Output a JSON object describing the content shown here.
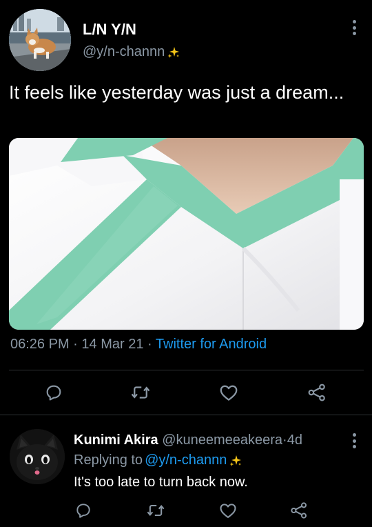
{
  "tweet": {
    "author_name": "L/N Y/N",
    "author_handle": "@y/n-channn",
    "text": "It feels like yesterday was just a dream...",
    "time": "06:26 PM",
    "date": "14 Mar 21",
    "source": "Twitter for Android",
    "meta_separator": "·"
  },
  "reply": {
    "author_name": "Kunimi Akira",
    "author_handle": "@kuneemeeakeera",
    "age": "4d",
    "replying_prefix": "Replying to",
    "replying_to": "@y/n-channn",
    "text": "It's too late to turn back now.",
    "separator": "·"
  },
  "icons": {
    "reply": "reply-icon",
    "retweet": "retweet-icon",
    "like": "heart-icon",
    "share": "share-icon",
    "more": "more-vertical-icon",
    "sparkles": "sparkles-icon"
  },
  "colors": {
    "background": "#000000",
    "text": "#ffffff",
    "muted": "#8b98a5",
    "link": "#1d9bf0",
    "divider": "#2f3336",
    "sparkle": "#f5c518",
    "mint": "#7fcfb1"
  }
}
